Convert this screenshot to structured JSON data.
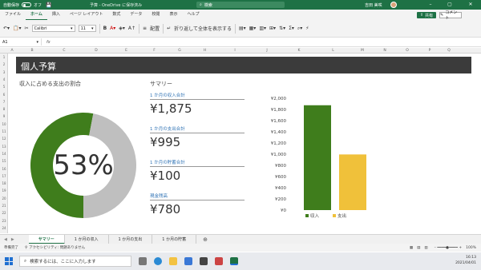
{
  "titlebar": {
    "autosave_label": "自動保存",
    "autosave_state": "オフ",
    "doc_title": "予算 - OneDrive に保存済み",
    "search_placeholder": "検索",
    "user_name": "吉田 美咲"
  },
  "menu": {
    "tabs": [
      "ファイル",
      "ホーム",
      "挿入",
      "ページ レイアウト",
      "数式",
      "データ",
      "校閲",
      "表示",
      "ヘルプ"
    ],
    "active": "ホーム",
    "share_label": "共有",
    "comment_label": "コメント"
  },
  "ribbon": {
    "font_name": "Calibri",
    "font_size": "11",
    "wrap_label": "折り返して全体を表示する",
    "align_label": "配置"
  },
  "formula": {
    "cell_ref": "A1",
    "fx": "fx"
  },
  "columns": [
    "A",
    "B",
    "C",
    "D",
    "E",
    "F",
    "G",
    "H",
    "I",
    "J",
    "K",
    "L",
    "M",
    "N",
    "O",
    "P",
    "Q"
  ],
  "rows": [
    "1",
    "2",
    "3",
    "4",
    "5",
    "6",
    "7",
    "8",
    "9",
    "10",
    "11",
    "12",
    "13",
    "14",
    "15",
    "16",
    "17",
    "18",
    "19",
    "20",
    "21",
    "22",
    "23",
    "24"
  ],
  "sheet": {
    "title": "個人予算",
    "donut_title": "収入に占める支出の割合",
    "summary_title": "サマリー",
    "donut_percent_label": "53%",
    "donut_spent_fraction": 0.53,
    "summary": [
      {
        "label": "1 か月の収入合計",
        "value": "¥1,875"
      },
      {
        "label": "1 か月の支出合計",
        "value": "¥995"
      },
      {
        "label": "1 か月の貯蓄合計",
        "value": "¥100"
      },
      {
        "label": "現金残高",
        "value": "¥780"
      }
    ]
  },
  "chart_data": {
    "type": "bar",
    "categories": [
      "収入",
      "支出"
    ],
    "values": [
      1875,
      995
    ],
    "ylim": [
      0,
      2000
    ],
    "ytick_labels": [
      "¥0",
      "¥200",
      "¥400",
      "¥600",
      "¥800",
      "¥1,000",
      "¥1,200",
      "¥1,400",
      "¥1,600",
      "¥1,800",
      "¥2,000"
    ],
    "ytick_values": [
      0,
      200,
      400,
      600,
      800,
      1000,
      1200,
      1400,
      1600,
      1800,
      2000
    ],
    "legend": [
      "収入",
      "支出"
    ],
    "legend_position": "bottom",
    "grid": false,
    "colors": [
      "#3f7d1c",
      "#f0c13a"
    ]
  },
  "sheet_tabs": [
    "サマリー",
    "1 か月の収入",
    "1 か月の支出",
    "1 か月の貯蓄"
  ],
  "active_sheet": "サマリー",
  "status": {
    "ready": "準備完了",
    "accessibility": "アクセシビリティ: 問題ありません",
    "zoom": "100%"
  },
  "taskbar": {
    "search_placeholder": "検索するには、ここに入力します",
    "time": "16:13",
    "date": "2021/04/01"
  },
  "colors": {
    "excel_green": "#1e7145",
    "donut_green": "#3f7d1c",
    "donut_gray": "#bfbfbf",
    "bar_yellow": "#f0c13a",
    "banner": "#3b3b3b",
    "summary_label": "#2f73b5"
  }
}
